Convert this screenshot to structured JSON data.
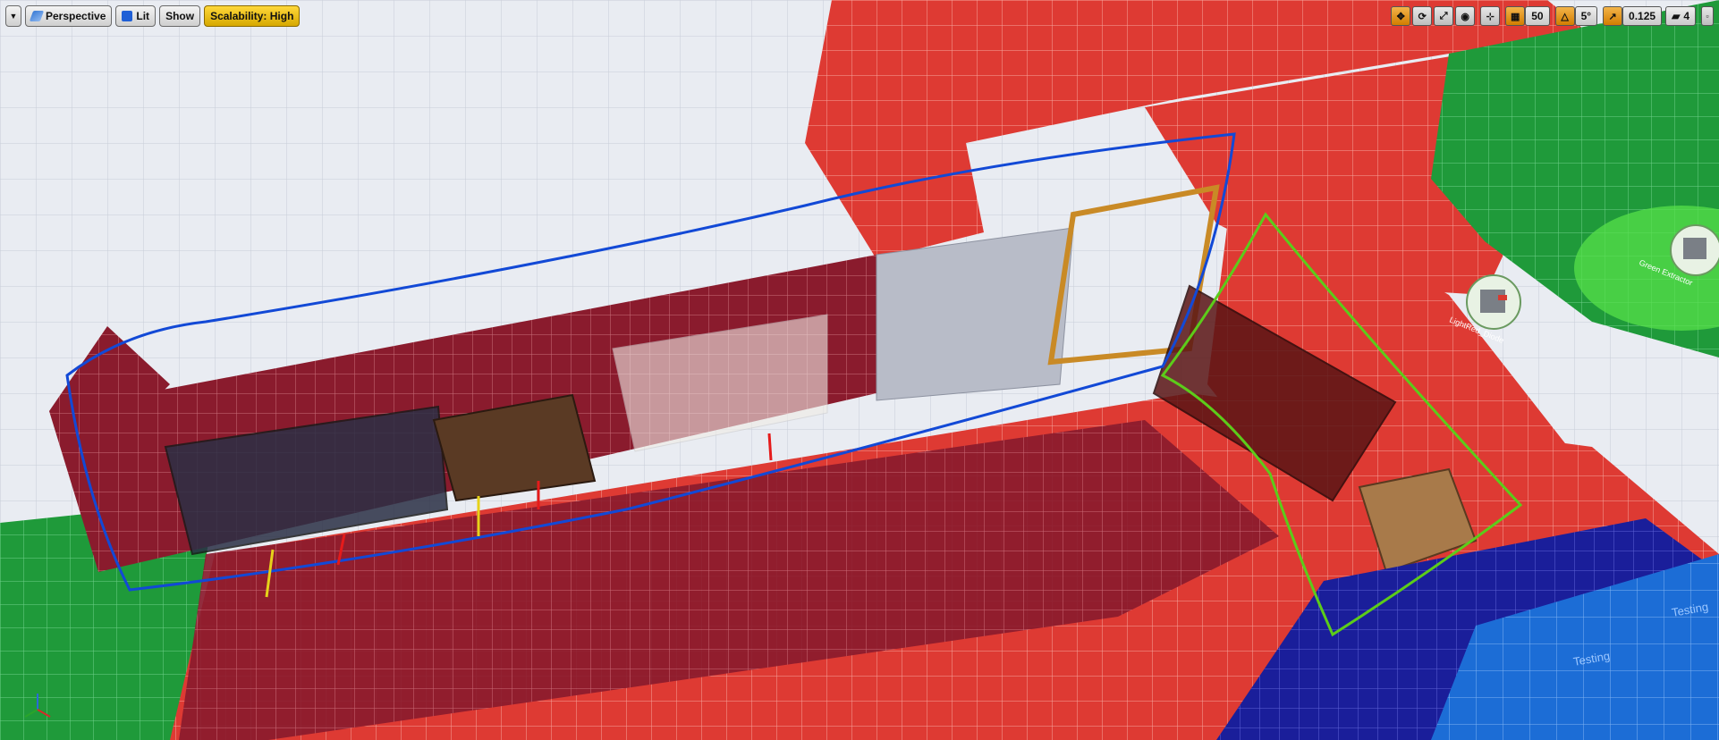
{
  "toolbar_left": {
    "menu_icon": "chevron-down-icon",
    "perspective_label": "Perspective",
    "lit_label": "Lit",
    "show_label": "Show",
    "scalability_label": "Scalability: High"
  },
  "toolbar_right": {
    "grid_snap_value": "50",
    "rotation_snap_value": "5°",
    "scale_snap_value": "0.125",
    "camera_speed_value": "4"
  },
  "scene": {
    "icon_lightmass_label": "LightRed_Diode",
    "icon_extractor_label": "Green Extractor",
    "floor_blue_label_1": "Testing",
    "floor_blue_label_2": "Testing"
  },
  "colors": {
    "accent_gold": "#d6a800",
    "red_wall": "#d8322c",
    "dark_red_wall": "#7a1424",
    "green_floor": "#1f9a3a",
    "blue_floor": "#1f6fd1",
    "selection_blue": "#1249d6",
    "selection_green": "#5ccc1a"
  }
}
